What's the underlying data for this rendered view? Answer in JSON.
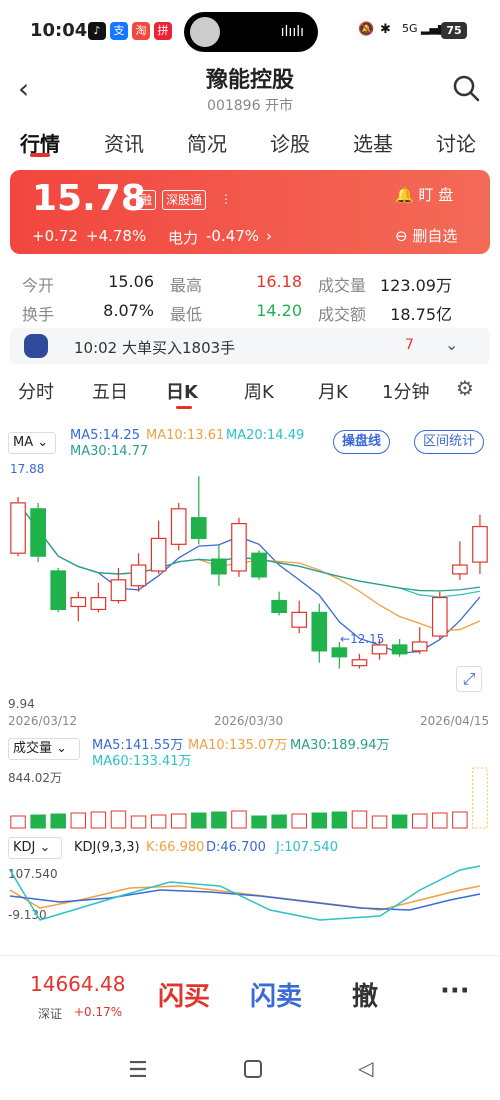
{
  "status": {
    "time": "10:04",
    "signal": "5G",
    "battery": "75"
  },
  "header": {
    "title": "豫能控股",
    "subtitle": "001896 开市"
  },
  "tabs": [
    "行情",
    "资讯",
    "简况",
    "诊股",
    "选基",
    "讨论"
  ],
  "quote": {
    "price": "15.78",
    "tag1": "融",
    "tag2": "深股通",
    "change": "+0.72",
    "change_pct": "+4.78%",
    "sector": "电力",
    "sector_pct": "-0.47%",
    "watch_label": "盯 盘",
    "remove_label": "删自选"
  },
  "stats": {
    "open_label": "今开",
    "open": "15.06",
    "high_label": "最高",
    "high": "16.18",
    "vol_label": "成交量",
    "vol": "123.09万",
    "turn_label": "换手",
    "turn": "8.07%",
    "low_label": "最低",
    "low": "14.20",
    "amt_label": "成交额",
    "amt": "18.75亿"
  },
  "news": {
    "text": "10:02 大单买入1803手",
    "count": "7"
  },
  "period_tabs": [
    "分时",
    "五日",
    "日K",
    "周K",
    "月K",
    "1分钟"
  ],
  "chart_legend": {
    "ma": "MA",
    "ma5": "MA5:14.25",
    "ma10": "MA10:13.61",
    "ma20": "MA20:14.49",
    "ma30": "MA30:14.77",
    "btn1": "操盘线",
    "btn2": "区间统计",
    "high_mark": "17.88",
    "low_mark": "12.15",
    "axis_min": "9.94",
    "dates": [
      "2026/03/12",
      "2026/03/30",
      "2026/04/15"
    ]
  },
  "volume": {
    "label": "成交量",
    "ma5": "MA5:141.55万",
    "ma10": "MA10:135.07万",
    "ma30": "MA30:189.94万",
    "ma60": "MA60:133.41万",
    "axis": "844.02万"
  },
  "kdj": {
    "label": "KDJ",
    "params": "KDJ(9,3,3)",
    "k": "K:66.980",
    "d": "D:46.700",
    "j": "J:107.540",
    "axis_top": "107.540",
    "axis_bottom": "-9.130"
  },
  "bottom": {
    "index_value": "14664.48",
    "index_name": "深证",
    "index_change": "+0.17%",
    "buy": "闪买",
    "sell": "闪卖",
    "cancel": "撤",
    "more": "···"
  },
  "colors": {
    "up": "#e2342c",
    "down": "#20b24b",
    "ma5": "#3a6ad8",
    "ma10": "#f0a040",
    "ma20": "#2cc2c8",
    "ma30": "#2aa08a"
  },
  "chart_data": {
    "type": "candlestick",
    "candles": [
      {
        "o": 14.9,
        "c": 16.6,
        "h": 16.8,
        "l": 14.8
      },
      {
        "o": 16.4,
        "c": 14.8,
        "h": 16.6,
        "l": 14.6
      },
      {
        "o": 14.3,
        "c": 13.0,
        "h": 14.4,
        "l": 12.9
      },
      {
        "o": 13.1,
        "c": 13.4,
        "h": 13.6,
        "l": 12.6
      },
      {
        "o": 13.0,
        "c": 13.4,
        "h": 13.9,
        "l": 12.9
      },
      {
        "o": 13.3,
        "c": 14.0,
        "h": 14.4,
        "l": 13.2
      },
      {
        "o": 13.8,
        "c": 14.5,
        "h": 14.9,
        "l": 13.6
      },
      {
        "o": 14.3,
        "c": 15.4,
        "h": 16.0,
        "l": 14.2
      },
      {
        "o": 15.2,
        "c": 16.4,
        "h": 16.6,
        "l": 15.0
      },
      {
        "o": 16.1,
        "c": 15.4,
        "h": 17.5,
        "l": 15.2
      },
      {
        "o": 14.7,
        "c": 14.2,
        "h": 15.2,
        "l": 13.8
      },
      {
        "o": 14.3,
        "c": 15.9,
        "h": 16.1,
        "l": 14.1
      },
      {
        "o": 14.9,
        "c": 14.1,
        "h": 15.0,
        "l": 14.0
      },
      {
        "o": 13.3,
        "c": 12.9,
        "h": 13.6,
        "l": 12.8
      },
      {
        "o": 12.4,
        "c": 12.9,
        "h": 13.3,
        "l": 12.2
      },
      {
        "o": 12.9,
        "c": 11.6,
        "h": 13.2,
        "l": 11.2
      },
      {
        "o": 11.7,
        "c": 11.4,
        "h": 11.9,
        "l": 11.0
      },
      {
        "o": 11.1,
        "c": 11.3,
        "h": 11.5,
        "l": 11.0
      },
      {
        "o": 11.5,
        "c": 11.8,
        "h": 12.0,
        "l": 11.3
      },
      {
        "o": 11.8,
        "c": 11.5,
        "h": 12.0,
        "l": 11.4
      },
      {
        "o": 11.6,
        "c": 11.9,
        "h": 12.4,
        "l": 11.5
      },
      {
        "o": 12.1,
        "c": 13.4,
        "h": 13.6,
        "l": 12.0
      },
      {
        "o": 14.2,
        "c": 14.5,
        "h": 15.3,
        "l": 14.0
      },
      {
        "o": 14.6,
        "c": 15.8,
        "h": 16.2,
        "l": 14.2
      }
    ],
    "ylim": [
      9.94,
      17.88
    ]
  }
}
